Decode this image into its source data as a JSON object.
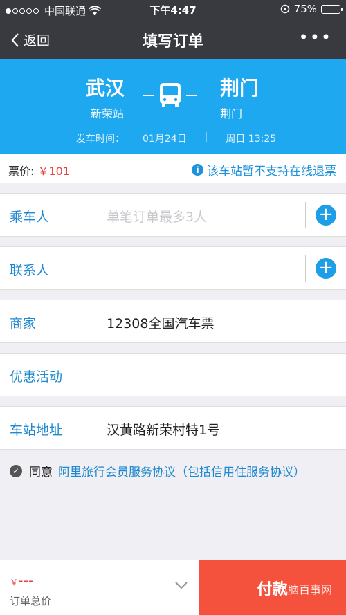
{
  "status_bar": {
    "carrier": "中国联通",
    "time": "下午4:47",
    "battery_percent": "75%"
  },
  "nav": {
    "back_label": "返回",
    "title": "填写订单",
    "more_icon": "more-dots"
  },
  "route": {
    "from_city": "武汉",
    "from_station": "新荣站",
    "to_city": "荆门",
    "to_station": "荆门",
    "departure_label": "发车时间：",
    "departure_date": "01月24日",
    "departure_day_time": "周日 13:25"
  },
  "price": {
    "label": "票价: ",
    "value": "￥101",
    "refund_note": "该车站暂不支持在线退票"
  },
  "passenger": {
    "label": "乘车人",
    "placeholder": "单笔订单最多3人"
  },
  "contact": {
    "label": "联系人"
  },
  "merchant": {
    "label": "商家",
    "value": "12308全国汽车票"
  },
  "promotion": {
    "label": "优惠活动"
  },
  "station_address": {
    "label": "车站地址",
    "value": "汉黄路新荣村特1号"
  },
  "agreement": {
    "prefix": "同意",
    "link": "阿里旅行会员服务协议（包括信用住服务协议）"
  },
  "bottom": {
    "total_currency": "￥",
    "total_amount": "---",
    "total_label": "订单总价",
    "pay_label": "付款",
    "watermark": "电脑百事网"
  },
  "colors": {
    "accent": "#1ea8f0",
    "link": "#1e88d0",
    "price": "#e64340",
    "pay": "#f5523d"
  }
}
